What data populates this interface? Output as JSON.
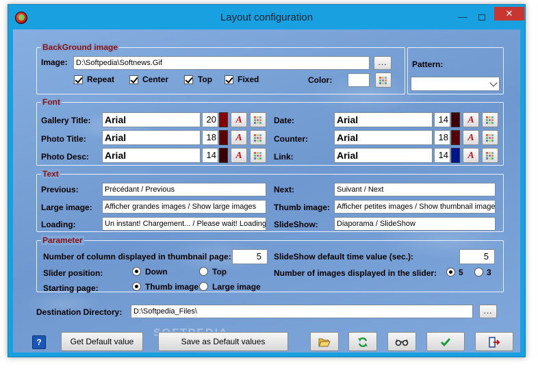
{
  "window": {
    "title": "Layout configuration",
    "minimize_glyph": "—",
    "close_glyph": "✕"
  },
  "background_group": {
    "title": "BackGround image",
    "image_label": "Image:",
    "image_value": "D:\\Softpedia\\Softnews.Gif",
    "browse_label": "...",
    "checks": [
      {
        "label": "Repeat",
        "checked": true
      },
      {
        "label": "Center",
        "checked": true
      },
      {
        "label": "Top",
        "checked": true
      },
      {
        "label": "Fixed",
        "checked": true
      }
    ],
    "color_label": "Color:",
    "color_value": ""
  },
  "pattern_group": {
    "label": "Pattern:",
    "selected": ""
  },
  "font_group": {
    "title": "Font",
    "rows": [
      {
        "label": "Gallery Title:",
        "font": "Arial",
        "size": "20",
        "color": "#8b0000"
      },
      {
        "label": "Photo Title:",
        "font": "Arial",
        "size": "18",
        "color": "#600000"
      },
      {
        "label": "Photo Desc:",
        "font": "Arial",
        "size": "14",
        "color": "#3a0000"
      },
      {
        "label": "Date:",
        "font": "Arial",
        "size": "14",
        "color": "#400000"
      },
      {
        "label": "Counter:",
        "font": "Arial",
        "size": "18",
        "color": "#5a0000"
      },
      {
        "label": "Link:",
        "font": "Arial",
        "size": "14",
        "color": "#00138f"
      }
    ],
    "font_button_glyph": "A"
  },
  "text_group": {
    "title": "Text",
    "rows": [
      {
        "label": "Previous:",
        "value": "Précédant / Previous"
      },
      {
        "label": "Large image:",
        "value": "Afficher grandes images / Show large images"
      },
      {
        "label": "Loading:",
        "value": "Un instant! Chargement... / Please wait! Loading..."
      },
      {
        "label": "Next:",
        "value": "Suivant / Next"
      },
      {
        "label": "Thumb image:",
        "value": "Afficher petites images / Show thumbnail images"
      },
      {
        "label": "SlideShow:",
        "value": "Diaporama / SlideShow"
      }
    ]
  },
  "parameter_group": {
    "title": "Parameter",
    "columns_label": "Number of column displayed in thumbnail page:",
    "columns_value": "5",
    "slideshow_time_label": "SlideShow default time value (sec.):",
    "slideshow_time_value": "5",
    "slider_position_label": "Slider position:",
    "slider_position_options": [
      "Down",
      "Top"
    ],
    "slider_position_selected": "Down",
    "slider_images_label": "Number of images displayed in the slider:",
    "slider_images_options": [
      "5",
      "3"
    ],
    "slider_images_selected": "5",
    "starting_page_label": "Starting page:",
    "starting_page_options": [
      "Thumb image",
      "Large image"
    ],
    "starting_page_selected": "Thumb image"
  },
  "destination": {
    "label": "Destination Directory:",
    "value": "D:\\Softpedia_Files\\",
    "browse_label": "..."
  },
  "bottom_bar": {
    "help_label": "?",
    "default_label": "Get Default value",
    "save_default_label": "Save as Default values",
    "watermark": "SOFTPEDIA"
  },
  "colors": {
    "group_title": "#8a1010",
    "titlebar": "#18a0e0",
    "close": "#c7372f"
  }
}
